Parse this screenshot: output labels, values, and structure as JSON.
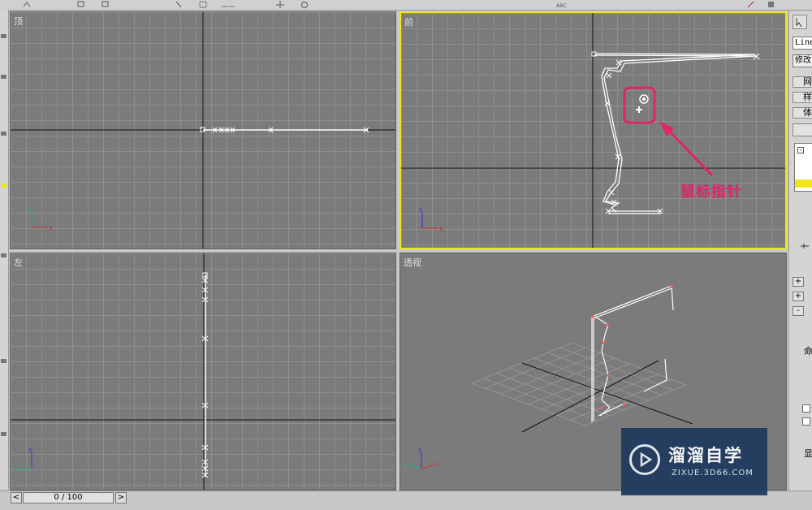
{
  "viewports": {
    "top": {
      "label": "顶"
    },
    "front": {
      "label": "前"
    },
    "left": {
      "label": "左"
    },
    "persp": {
      "label": "透视"
    }
  },
  "right_panel": {
    "object_type": "Line",
    "modifier_list": "修改",
    "buttons": [
      "网",
      "样条",
      "体"
    ],
    "rollout_plus_1": "+",
    "rollout_plus_2": "+",
    "rollout_minus": "-",
    "section_label_1": "命",
    "section_label_2": "显"
  },
  "timeline": {
    "frame_display": "0 / 100",
    "prev": "<",
    "next": ">"
  },
  "annotation": {
    "text": "鼠标指针",
    "color": "#e0246a"
  },
  "watermark": {
    "title": "溜溜自学",
    "url": "ZIXUE.3D66.COM"
  },
  "colors": {
    "viewport_bg": "#7b7b7b",
    "active_border": "#f2e41a",
    "spline": "#ffffff"
  }
}
